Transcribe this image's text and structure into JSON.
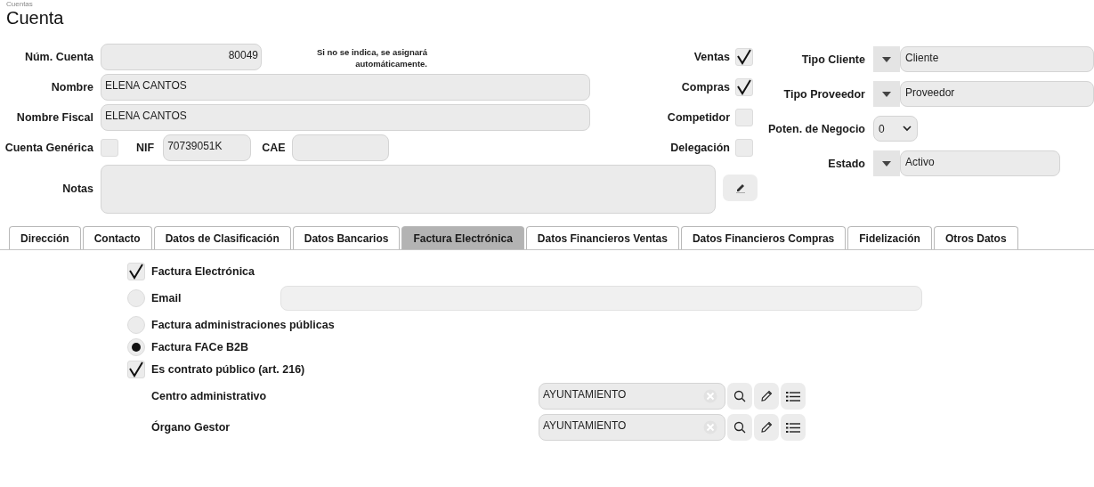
{
  "breadcrumb": "Cuentas",
  "title": "Cuenta",
  "num_cuenta": {
    "label": "Núm. Cuenta",
    "value": "80049",
    "hint": "Si no se indica, se asignará automáticamente."
  },
  "nombre": {
    "label": "Nombre",
    "value": "ELENA CANTOS"
  },
  "nombre_fiscal": {
    "label": "Nombre Fiscal",
    "value": "ELENA CANTOS"
  },
  "cuenta_generica": {
    "label": "Cuenta Genérica",
    "checked": false
  },
  "nif": {
    "label": "NIF",
    "value": "70739051K"
  },
  "cae": {
    "label": "CAE"
  },
  "notas": {
    "label": "Notas"
  },
  "flags": [
    {
      "label": "Ventas",
      "checked": true
    },
    {
      "label": "Compras",
      "checked": true
    },
    {
      "label": "Competidor",
      "checked": false
    },
    {
      "label": "Delegación",
      "checked": false
    }
  ],
  "selectors": [
    {
      "kind": "combo",
      "label": "Tipo Cliente",
      "value": "Cliente"
    },
    {
      "kind": "combo",
      "label": "Tipo Proveedor",
      "value": "Proveedor"
    },
    {
      "kind": "select",
      "label": "Poten. de Negocio",
      "value": "0"
    },
    {
      "kind": "combo",
      "label": "Estado",
      "value": "Activo"
    }
  ],
  "tabs": [
    {
      "label": "Dirección",
      "selected": false
    },
    {
      "label": "Contacto",
      "selected": false
    },
    {
      "label": "Datos de Clasificación",
      "selected": false
    },
    {
      "label": "Datos Bancarios",
      "selected": false
    },
    {
      "label": "Factura Electrónica",
      "selected": true
    },
    {
      "label": "Datos Financieros Ventas",
      "selected": false
    },
    {
      "label": "Datos Financieros Compras",
      "selected": false
    },
    {
      "label": "Fidelización",
      "selected": false
    },
    {
      "label": "Otros Datos",
      "selected": false
    }
  ],
  "invoice_options": [
    {
      "kind": "checkbox",
      "label": "Factura Electrónica",
      "checked": true
    },
    {
      "kind": "radio-field",
      "label": "Email",
      "selected": false
    },
    {
      "kind": "radio",
      "label": "Factura administraciones públicas",
      "selected": false
    },
    {
      "kind": "radio",
      "label": "Factura FACe B2B",
      "selected": true
    },
    {
      "kind": "checkbox",
      "label": "Es contrato público (art. 216)",
      "checked": true
    }
  ],
  "lookups": [
    {
      "label": "Centro administrativo",
      "value": "AYUNTAMIENTO"
    },
    {
      "label": "Órgano Gestor",
      "value": "AYUNTAMIENTO"
    }
  ]
}
